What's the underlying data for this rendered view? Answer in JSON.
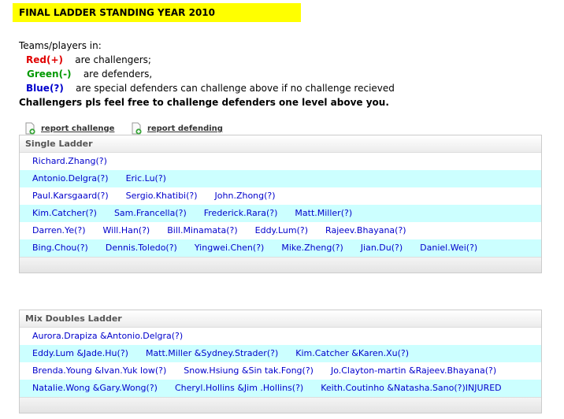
{
  "banner": {
    "title": "FINAL LADDER STANDING YEAR  2010"
  },
  "legend": {
    "intro": "Teams/players in:",
    "red_label": "Red(+)",
    "red_desc": "are challengers;",
    "green_label": "Green(-)",
    "green_desc": "are defenders,",
    "blue_label": "Blue(?)",
    "blue_desc": "are special defenders can challenge above if no challenge recieved",
    "note": "Challengers pls feel free to challenge defenders one level above you."
  },
  "actions": {
    "report_challenge": "report challenge",
    "report_defending": "report defending"
  },
  "single_ladder": {
    "title": "Single Ladder",
    "rows": [
      [
        "Richard.Zhang(?)"
      ],
      [
        "Antonio.Delgra(?)",
        "Eric.Lu(?)"
      ],
      [
        "Paul.Karsgaard(?)",
        "Sergio.Khatibi(?)",
        "John.Zhong(?)"
      ],
      [
        "Kim.Catcher(?)",
        "Sam.Francella(?)",
        "Frederick.Rara(?)",
        "Matt.Miller(?)"
      ],
      [
        "Darren.Ye(?)",
        "Will.Han(?)",
        "Bill.Minamata(?)",
        "Eddy.Lum(?)",
        "Rajeev.Bhayana(?)"
      ],
      [
        "Bing.Chou(?)",
        "Dennis.Toledo(?)",
        "Yingwei.Chen(?)",
        "Mike.Zheng(?)",
        "Jian.Du(?)",
        "Daniel.Wei(?)"
      ]
    ]
  },
  "mix_doubles_ladder": {
    "title": "Mix Doubles Ladder",
    "rows": [
      [
        "Aurora.Drapiza &Antonio.Delgra(?)"
      ],
      [
        "Eddy.Lum &Jade.Hu(?)",
        "Matt.Miller &Sydney.Strader(?)",
        "Kim.Catcher &Karen.Xu(?)"
      ],
      [
        "Brenda.Young &Ivan.Yuk low(?)",
        "Snow.Hsiung &Sin tak.Fong(?)",
        "Jo.Clayton-martin &Rajeev.Bhayana(?)"
      ],
      [
        "Natalie.Wong &Gary.Wong(?)",
        "Cheryl.Hollins &Jim .Hollins(?)",
        "Keith.Coutinho &Natasha.Sano(?)INJURED"
      ]
    ]
  },
  "colors": {
    "banner": "#ffff00",
    "row_alt": "#ccffff",
    "link": "#0000cc",
    "red": "#e00000",
    "green": "#009900"
  },
  "icons": {
    "report": "document-add-icon"
  }
}
